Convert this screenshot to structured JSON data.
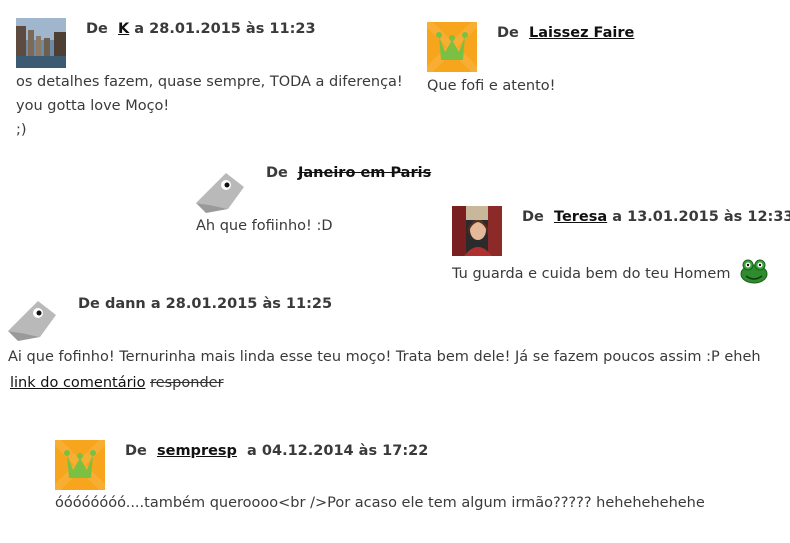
{
  "comments": [
    {
      "prefix": "De",
      "author": "K",
      "date_sep": "a",
      "date": "28.01.2015 às 11:23",
      "lines": [
        "os detalhes fazem, quase sempre, TODA a diferença!",
        "you gotta love Moço!",
        ";)"
      ],
      "avatar": "photo-avatar"
    },
    {
      "prefix": "De",
      "author": "Laissez Faire",
      "lines": [
        "Que fofi e atento!"
      ],
      "avatar": "crown-avatar"
    },
    {
      "prefix": "De",
      "author": "Janeiro em Paris",
      "lines": [
        "Ah que fofiinho! :D"
      ],
      "avatar": "fish-avatar"
    },
    {
      "prefix": "De",
      "author": "Teresa",
      "date_sep": "a",
      "date": "13.01.2015 às 12:33",
      "lines": [
        "Tu guarda e cuida bem do teu Homem"
      ],
      "avatar": "photo-avatar"
    },
    {
      "prefix": "De",
      "author": "dann",
      "date_sep": "a",
      "date": "28.01.2015 às 11:25",
      "lines": [
        "Ai que fofinho! Ternurinha mais linda esse teu moço! Trata bem dele! Já se fazem poucos assim :P eheh"
      ],
      "link_label": "link do comentário",
      "reply_label": "responder",
      "avatar": "fish-avatar"
    },
    {
      "prefix": "De",
      "author": "sempresp",
      "date_sep": "a",
      "date": "04.12.2014 às 17:22",
      "lines": [
        "óóóóóóóó....também queroooo<br />Por acaso ele tem algum irmão????? hehehehehehe"
      ],
      "avatar": "crown-avatar"
    }
  ],
  "colors": {
    "crown_bg": "#f7a51c",
    "crown": "#7bc043",
    "fish": "#b9b9b9"
  }
}
